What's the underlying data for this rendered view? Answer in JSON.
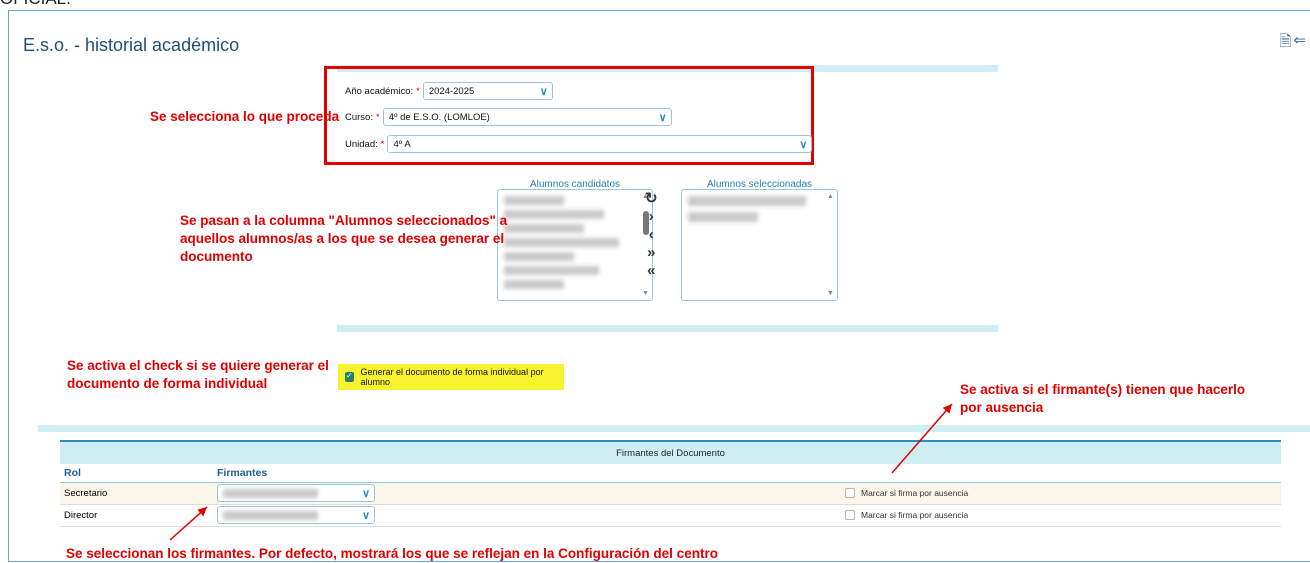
{
  "top_cut_text": "OFICIAL.",
  "header": {
    "title": "E.s.o. - historial académico"
  },
  "filters": {
    "year_label": "Año académico:",
    "year_value": "2024-2025",
    "course_label": "Curso:",
    "course_value": "4º de E.S.O. (LOMLOE)",
    "unit_label": "Unidad:",
    "unit_value": "4º A",
    "required_mark": "*"
  },
  "lists": {
    "candidates_title": "Alumnos candidatos",
    "selected_title": "Alumnos seleccionadas"
  },
  "individual_check": {
    "label": "Generar el documento de forma individual por alumno",
    "checked": true
  },
  "signers": {
    "title": "Firmantes del Documento",
    "col_role": "Rol",
    "col_signers": "Firmantes",
    "absence_label": "Marcar si firma por ausencia",
    "rows": [
      {
        "role": "Secretario"
      },
      {
        "role": "Director"
      }
    ]
  },
  "annotations": {
    "a1": "Se selecciona lo que proceda",
    "a2_l1": "Se pasan a la columna \"Alumnos seleccionados\" a",
    "a2_l2": "aquellos alumnos/as a los que se desea generar el",
    "a2_l3": "documento",
    "a3_l1": "Se activa el check si se quiere generar el",
    "a3_l2": "documento de forma individual",
    "a4_l1": "Se activa si el firmante(s) tienen que hacerlo",
    "a4_l2": "por ausencia",
    "a5": "Se seleccionan los firmantes. Por defecto, mostrará los que se reflejan en la Configuración del centro"
  },
  "colors": {
    "accent": "#2d8fb5",
    "annotation": "#e10000",
    "band": "#cfeef3",
    "highlight": "#f7f32e"
  }
}
